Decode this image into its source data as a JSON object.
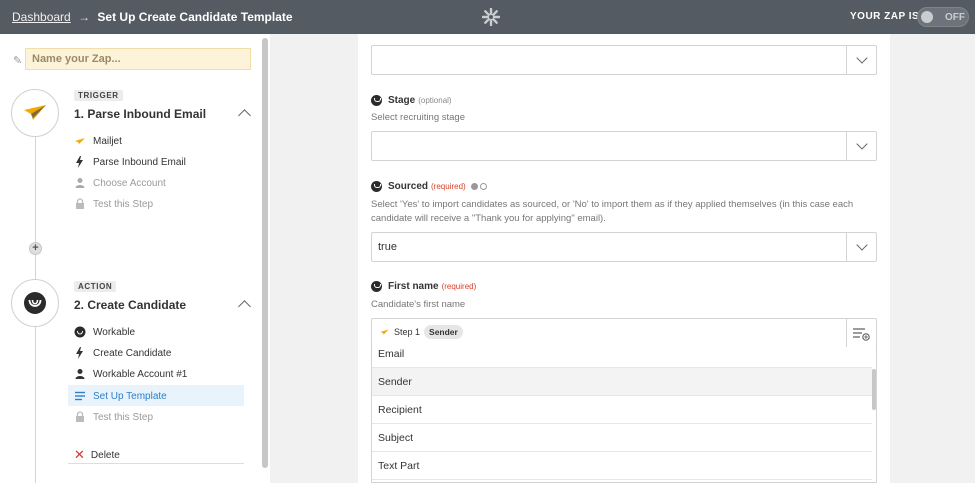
{
  "topbar": {
    "breadcrumb_link": "Dashboard",
    "breadcrumb_arrow": "→",
    "breadcrumb_current": "Set Up Create Candidate Template",
    "zap_is_label": "YOUR ZAP IS",
    "toggle_label": "OFF"
  },
  "sidebar": {
    "zap_name_placeholder": "Name your Zap...",
    "trigger": {
      "tag": "TRIGGER",
      "title": "1. Parse Inbound Email",
      "items": [
        "Mailjet",
        "Parse Inbound Email",
        "Choose Account",
        "Test this Step"
      ]
    },
    "action": {
      "tag": "ACTION",
      "title": "2. Create Candidate",
      "items": [
        "Workable",
        "Create Candidate",
        "Workable Account #1",
        "Set Up Template",
        "Test this Step"
      ]
    },
    "delete_label": "Delete"
  },
  "form": {
    "stage_label": "Stage",
    "stage_optional": "(optional)",
    "stage_help": "Select recruiting stage",
    "sourced_label": "Sourced",
    "sourced_required": "(required)",
    "sourced_help": "Select 'Yes' to import candidates as sourced, or 'No' to import them as if they applied themselves (in this case each candidate will receive a \"Thank you for applying\" email).",
    "sourced_value": "true",
    "first_name_label": "First name",
    "first_name_required": "(required)",
    "first_name_help": "Candidate's first name",
    "pill_step": "Step 1",
    "pill_field": "Sender",
    "dropdown_items": [
      "Email",
      "Sender",
      "Recipient",
      "Subject",
      "Text Part"
    ]
  },
  "colors": {
    "topbar": "#545b62",
    "required": "#d9402b",
    "active_row": "#e8f3fc",
    "mailjet_accent": "#f2a900"
  }
}
